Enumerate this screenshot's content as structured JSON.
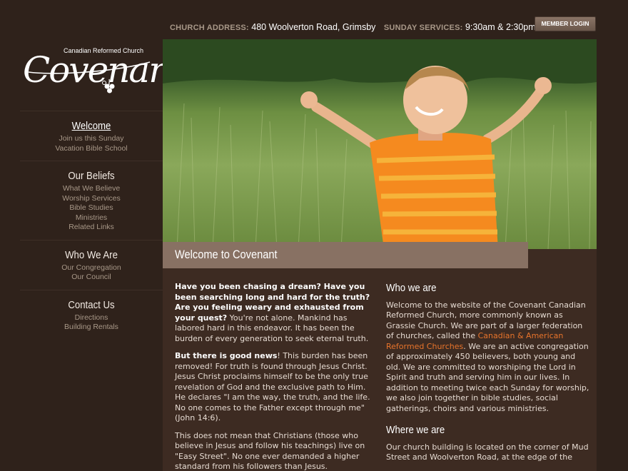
{
  "topbar": {
    "address_label": "CHURCH ADDRESS:",
    "address_value": "480 Woolverton Road, Grimsby",
    "services_label": "SUNDAY SERVICES:",
    "services_value": "9:30am & 2:30pm",
    "login_label": "MEMBER LOGIN"
  },
  "logo": {
    "subtitle": "Canadian Reformed Church",
    "name": "Covenant"
  },
  "sidebar": {
    "groups": [
      {
        "heading": "Welcome",
        "items": [
          "Join us this Sunday",
          "Vacation Bible School"
        ]
      },
      {
        "heading": "Our Beliefs",
        "items": [
          "What We Believe",
          "Worship Services",
          "Bible Studies",
          "Ministries",
          "Related Links"
        ]
      },
      {
        "heading": "Who We Are",
        "items": [
          "Our Congregation",
          "Our Council"
        ]
      },
      {
        "heading": "Contact Us",
        "items": [
          "Directions",
          "Building Rentals"
        ]
      }
    ]
  },
  "banner": {
    "title": "Welcome to Covenant"
  },
  "left_col": {
    "p1_bold": "Have you been chasing a dream? Have you been searching long and hard for the truth? Are you feeling weary and exhausted from your quest?",
    "p1_rest": " You're not alone. Mankind has labored hard in this endeavor. It has been the burden of every generation to seek eternal truth.",
    "p2_bold": "But there is good news",
    "p2_rest": "! This burden has been removed! For truth is found through Jesus Christ. Jesus Christ proclaims himself to be the only true revelation of God and the exclusive path to Him. He declares \"I am the way, the truth, and the life. No one comes to the Father except through me\" (John 14:6).",
    "p3": "This does not mean that Christians (those who believe in Jesus and follow his teachings) live on \"Easy Street\". No one ever demanded a higher standard from his followers than Jesus."
  },
  "right_col": {
    "h1": "Who we are",
    "p1_a": "Welcome to the website of the Covenant Canadian Reformed Church, more commonly known as Grassie Church. We are part of a larger federation of churches, called the ",
    "p1_link": "Canadian & American Reformed Churches",
    "p1_b": ". We are an active congregation of approximately 450 believers, both young and old. We are committed to worshiping the Lord in Spirit and truth and serving him in our lives. In addition to meeting twice each Sunday for worship, we also join together in bible studies, social gatherings, choirs and various ministries.",
    "h2": "Where we are",
    "p2": "Our church building is located on the corner of Mud Street and Woolverton Road, at the edge of the"
  },
  "colors": {
    "background": "#2f221b",
    "content": "#3d2b22",
    "banner": "#887163",
    "link": "#e8742b"
  }
}
